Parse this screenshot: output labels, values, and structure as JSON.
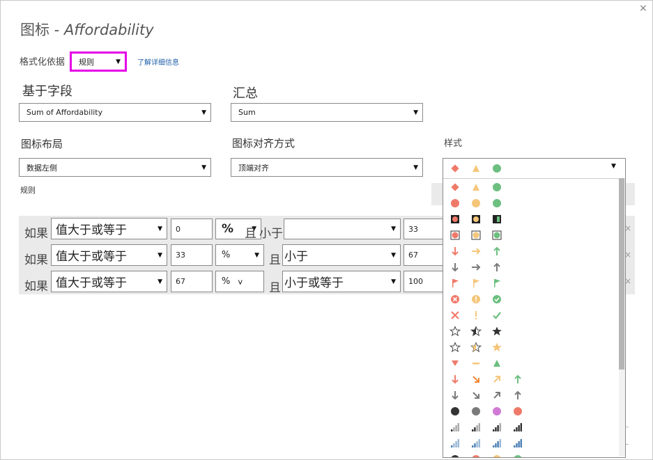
{
  "dialog": {
    "title_prefix": "图标 - ",
    "title_field": "Affordability",
    "close_glyph": "×",
    "format_by_label": "格式化依据",
    "format_by_value": "规则",
    "learn_more": "了解详细信息",
    "based_on_field_label": "基于字段",
    "based_on_field_value": "Sum of Affordability",
    "summarization_label": "汇总",
    "summarization_value": "Sum",
    "icon_layout_label": "图标布局",
    "icon_layout_value": "数据左侧",
    "icon_alignment_label": "图标对齐方式",
    "icon_alignment_value": "顶端对齐",
    "style_label": "样式",
    "rules_label": "规则"
  },
  "rules": [
    {
      "if": "如果",
      "op": "值大于或等于",
      "value": "0",
      "unit": "%",
      "and": "且",
      "op2": "小于",
      "value2": "33"
    },
    {
      "if": "如果",
      "op": "值大于或等于",
      "value": "33",
      "unit": "%",
      "and": "且",
      "op2": "小于",
      "value2": "67"
    },
    {
      "if": "如果",
      "op": "值大于或等于",
      "value": "67",
      "unit": "%",
      "and": "且",
      "op2": "小于或等于",
      "value2": "100"
    }
  ],
  "style_dropdown": {
    "selected": [
      "red-diamond-icon",
      "yellow-triangle-icon",
      "green-circle-icon"
    ],
    "options": [
      [
        "red-diamond-icon",
        "yellow-triangle-icon",
        "green-circle-icon"
      ],
      [
        "red-circle-icon",
        "yellow-circle-icon",
        "green-circle-icon"
      ],
      [
        "red-square-dot-icon",
        "yellow-square-dot-icon",
        "green-square-half-icon"
      ],
      [
        "red-outlined-circle-icon",
        "yellow-outlined-circle-icon",
        "green-outlined-circle-icon"
      ],
      [
        "red-arrow-down-icon",
        "yellow-arrow-right-icon",
        "green-arrow-up-icon"
      ],
      [
        "gray-arrow-down-icon",
        "gray-arrow-right-icon",
        "gray-arrow-up-icon"
      ],
      [
        "red-flag-icon",
        "yellow-flag-icon",
        "green-flag-icon"
      ],
      [
        "red-x-circle-icon",
        "yellow-exclaim-circle-icon",
        "green-check-circle-icon"
      ],
      [
        "red-x-icon",
        "yellow-exclaim-icon",
        "green-check-icon"
      ],
      [
        "empty-star-icon",
        "half-star-icon",
        "full-star-icon"
      ],
      [
        "empty-star-gold-icon",
        "half-star-gold-icon",
        "full-star-gold-icon"
      ],
      [
        "red-triangle-down-icon",
        "yellow-dash-icon",
        "green-triangle-up-icon"
      ],
      [
        "red-arrow-down-icon",
        "orange-arrow-downright-icon",
        "yellow-arrow-upright-icon",
        "green-arrow-up-icon"
      ],
      [
        "gray-arrow-down-icon",
        "gray-arrow-downright-icon",
        "gray-arrow-upright-icon",
        "gray-arrow-up-icon"
      ],
      [
        "black-circle-icon",
        "gray-circle-icon",
        "pink-circle-icon",
        "red-circle-icon"
      ],
      [
        "signal-1-icon",
        "signal-2-icon",
        "signal-3-icon",
        "signal-4-icon"
      ],
      [
        "signal-blue-1-icon",
        "signal-blue-2-icon",
        "signal-blue-3-icon",
        "signal-blue-4-icon"
      ],
      [
        "black-circle-icon",
        "red-circle-icon",
        "yellow-circle-icon",
        "green-circle-icon"
      ]
    ]
  },
  "colors": {
    "red": "#f07a6a",
    "orange": "#f28a3a",
    "yellow": "#f5c67a",
    "green": "#6cbf7f",
    "gray": "#7a7a7a",
    "highlight": "#e600e6",
    "link": "#1f5fa8"
  }
}
